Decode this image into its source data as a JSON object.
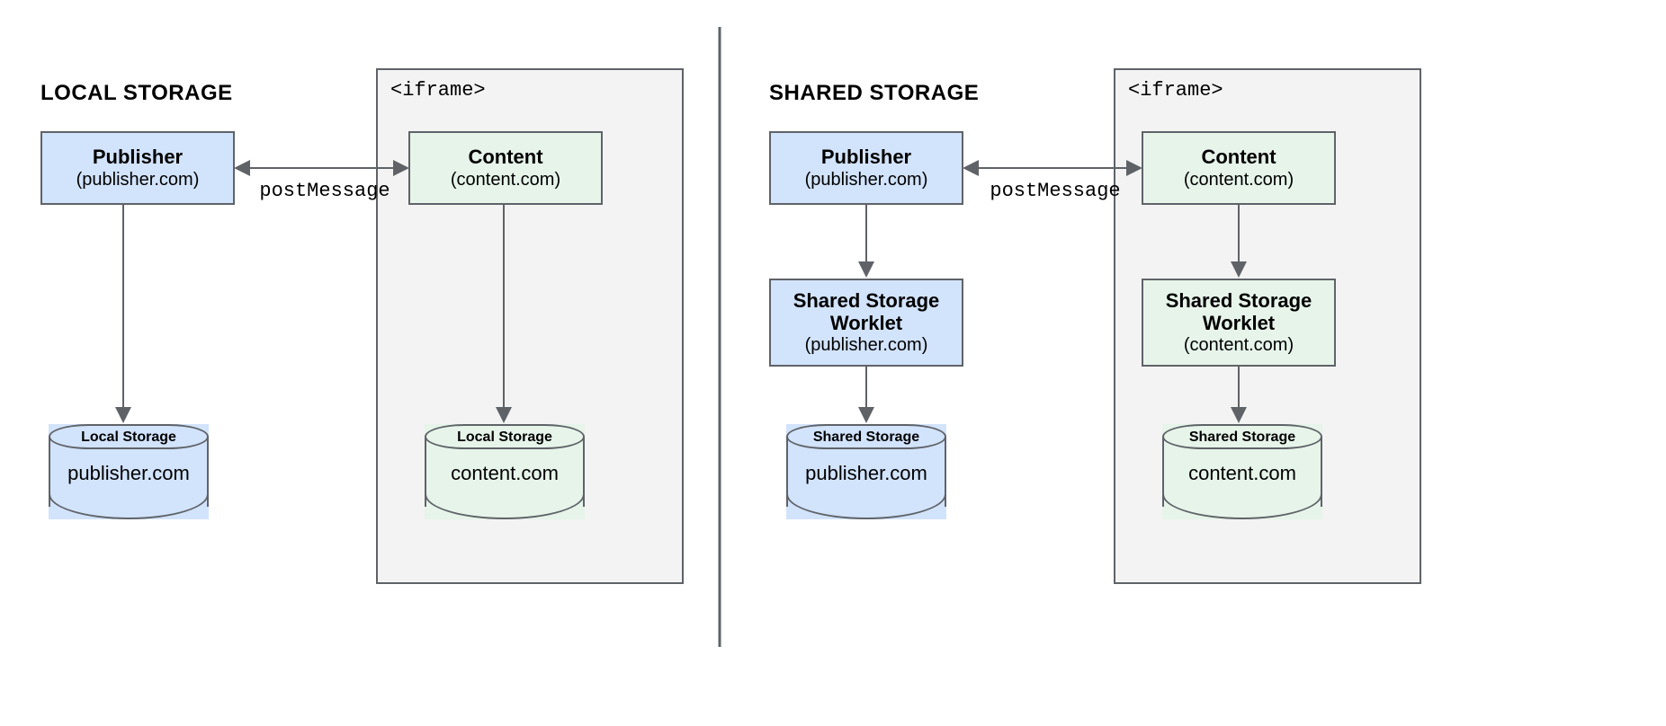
{
  "left": {
    "title": "LOCAL STORAGE",
    "iframe_label": "<iframe>",
    "publisher": {
      "title": "Publisher",
      "sub": "(publisher.com)"
    },
    "content": {
      "title": "Content",
      "sub": "(content.com)"
    },
    "post_message": "postMessage",
    "cyl_pub": {
      "top": "Local Storage",
      "mid": "publisher.com"
    },
    "cyl_con": {
      "top": "Local Storage",
      "mid": "content.com"
    }
  },
  "right": {
    "title": "SHARED STORAGE",
    "iframe_label": "<iframe>",
    "publisher": {
      "title": "Publisher",
      "sub": "(publisher.com)"
    },
    "content": {
      "title": "Content",
      "sub": "(content.com)"
    },
    "post_message": "postMessage",
    "worklet_pub": {
      "t1a": "Shared Storage",
      "t1b": "Worklet",
      "sub": "(publisher.com)"
    },
    "worklet_con": {
      "t1a": "Shared Storage",
      "t1b": "Worklet",
      "sub": "(content.com)"
    },
    "cyl_pub": {
      "top": "Shared Storage",
      "mid": "publisher.com"
    },
    "cyl_con": {
      "top": "Shared Storage",
      "mid": "content.com"
    }
  }
}
